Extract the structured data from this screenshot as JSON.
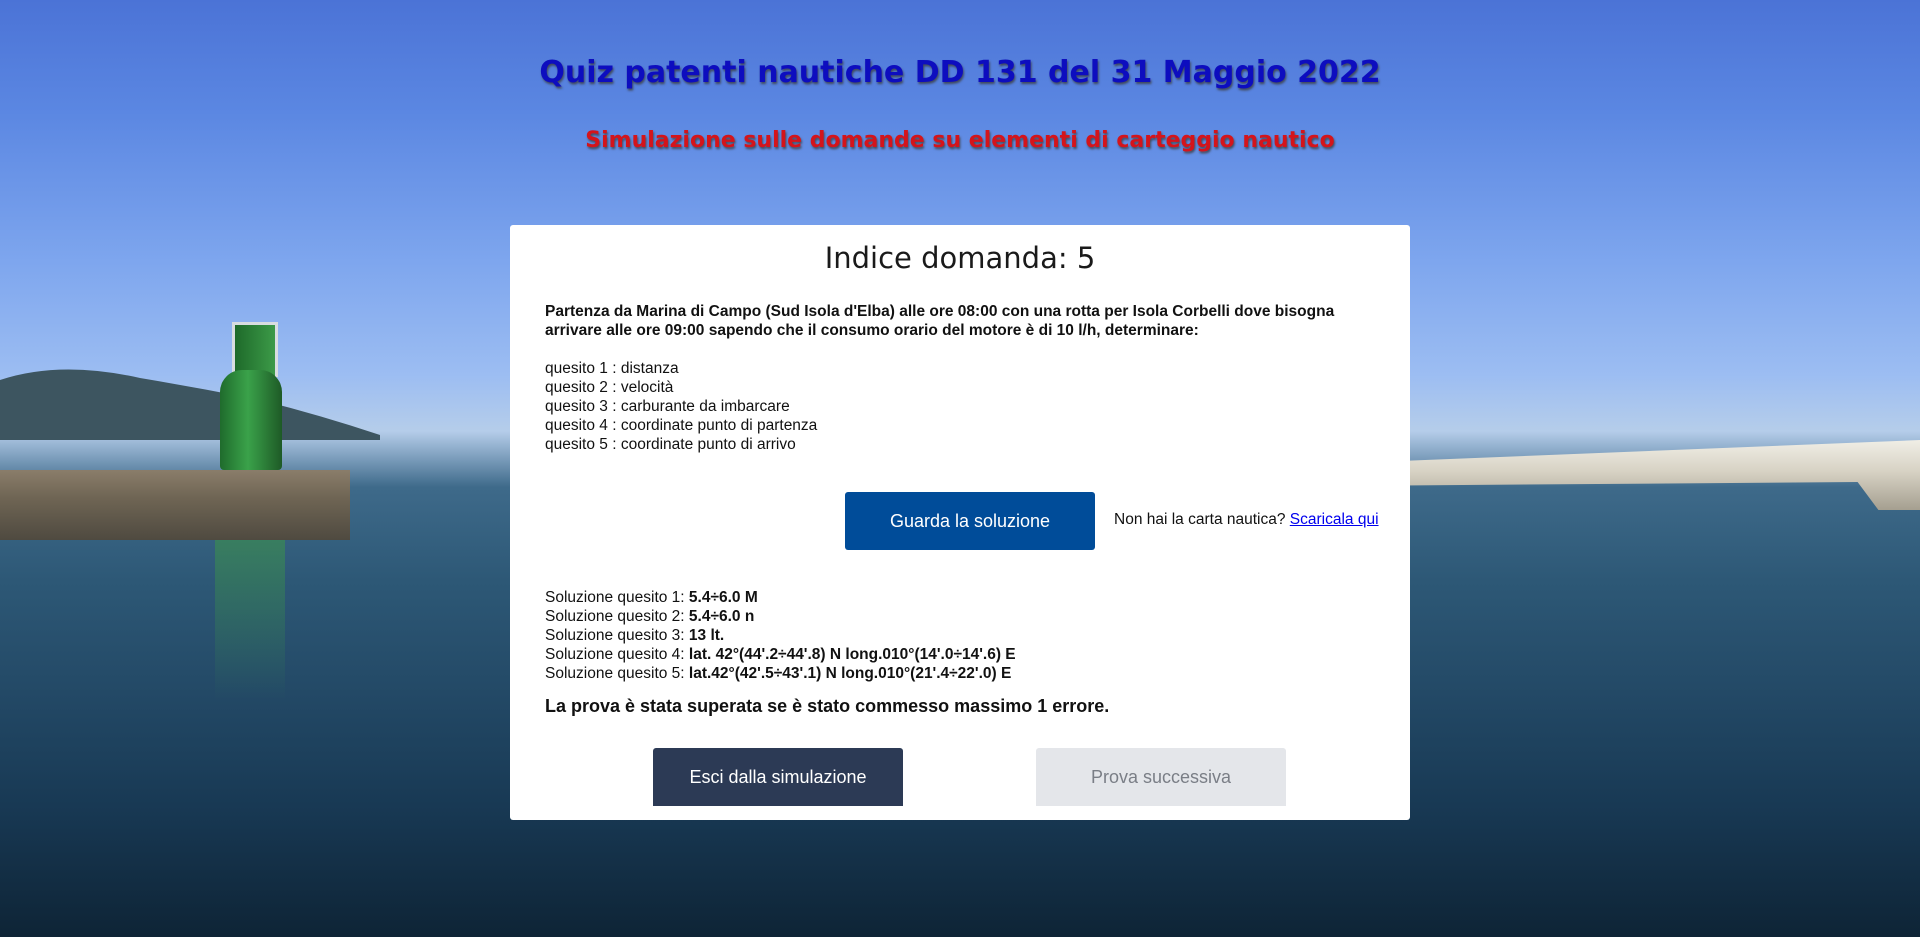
{
  "header": {
    "title": "Quiz patenti nautiche DD 131 del 31 Maggio 2022",
    "subtitle": "Simulazione sulle domande su elementi di carteggio nautico"
  },
  "card": {
    "title": "Indice domanda: 5",
    "question": "Partenza da Marina di Campo (Sud Isola d'Elba) alle ore 08:00 con una rotta per Isola Corbelli dove bisogna arrivare alle ore 09:00 sapendo che il consumo orario del motore è di 10 l/h, determinare:",
    "subquestions": [
      "quesito 1 : distanza",
      "quesito 2 : velocità",
      "quesito 3 : carburante da imbarcare",
      "quesito 4 : coordinate punto di partenza",
      "quesito 5 : coordinate punto di arrivo"
    ],
    "solution_button": "Guarda la soluzione",
    "chart_note": "Non hai la carta nautica?",
    "chart_link": "Scaricala qui",
    "solutions": [
      {
        "label": "Soluzione quesito 1: ",
        "value": "5.4÷6.0 M"
      },
      {
        "label": "Soluzione quesito 2: ",
        "value": "5.4÷6.0 n"
      },
      {
        "label": "Soluzione quesito 3: ",
        "value": "13 lt."
      },
      {
        "label": "Soluzione quesito 4: ",
        "value": "lat. 42°(44'.2÷44'.8) N long.010°(14'.0÷14'.6) E"
      },
      {
        "label": "Soluzione quesito 5: ",
        "value": "lat.42°(42'.5÷43'.1) N long.010°(21'.4÷22'.0) E"
      }
    ],
    "verdict": "La prova è stata superata se è stato commesso massimo 1 errore.",
    "exit_button": "Esci dalla simulazione",
    "next_button": "Prova successiva"
  },
  "colors": {
    "title": "#0d0dbf",
    "subtitle": "#d4141b",
    "primary_button": "#004c99",
    "exit_button": "#2c3a55",
    "disabled_button": "#e4e6ea"
  }
}
